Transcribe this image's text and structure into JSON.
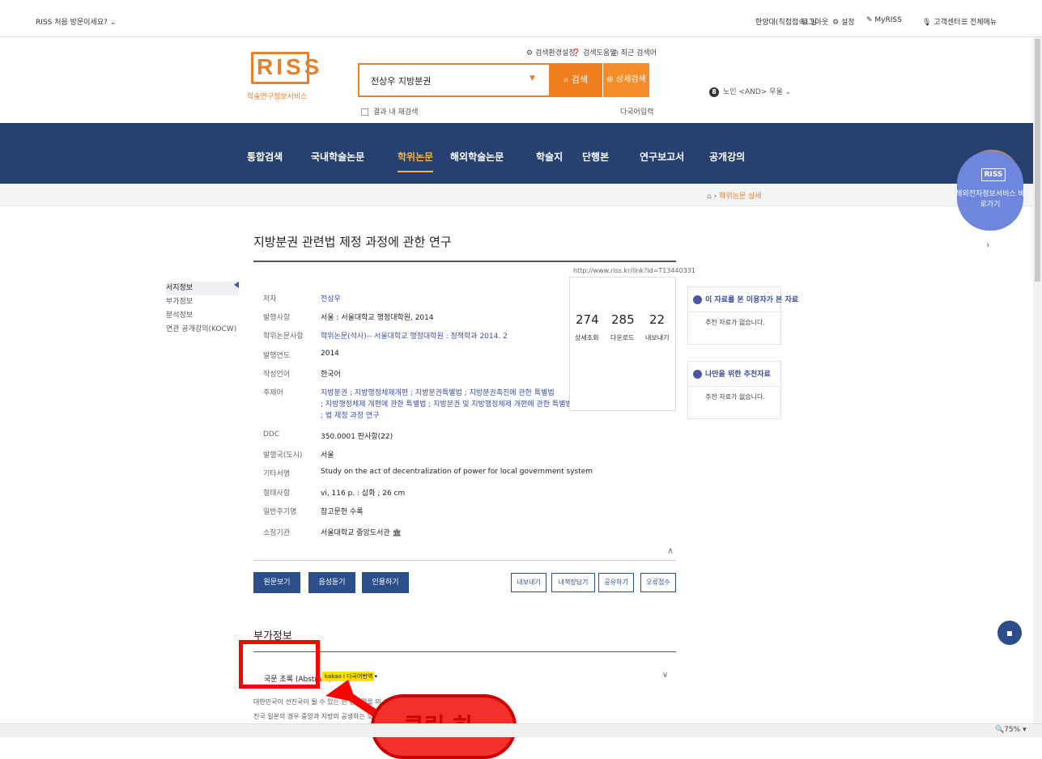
{
  "topbar": {
    "welcome": "RISS 처음 방문이세요? ⌄",
    "user": "한양대(직접접속) 님",
    "logout": "로그아웃",
    "settings": "설정",
    "myriss": "MyRISS",
    "support": "고객센터",
    "menu": "전체메뉴"
  },
  "header": {
    "logo_text": "RISS",
    "logo_sub": "학술연구정보서비스",
    "quick_links": [
      "검색환경설정",
      "검색도움말",
      "최근 검색어"
    ],
    "search_value": "전상우 지방분권",
    "search_button": "검색",
    "advanced_button": "상세검색",
    "within_results": "결과 내 재검색",
    "multilang": "다국어입력",
    "trending_rank": "8",
    "trending_text": "노인 <AND> 우울 ⌄"
  },
  "gnb": {
    "items": [
      "통합검색",
      "국내학술논문",
      "학위논문",
      "해외학술논문",
      "학술지",
      "단행본",
      "연구보고서",
      "공개강의"
    ],
    "active_index": 2
  },
  "breadcrumb": {
    "home": "⌂",
    "current": "학위논문 상세"
  },
  "float_banner": {
    "logo": "RISS",
    "text": "해외전자정보서비스 바로가기",
    "next": "›"
  },
  "article": {
    "title": "지방분권 관련법 제정 과정에 관한 연구",
    "url": "http://www.riss.kr/link?id=T13440331",
    "left_nav": [
      "서지정보",
      "부가정보",
      "분석정보",
      "연관 공개강의(KOCW)"
    ],
    "fields": [
      {
        "label": "저자",
        "value": "전상우",
        "link": true
      },
      {
        "label": "발행사항",
        "value": "서울 : 서울대학교 행정대학원, 2014",
        "link": false
      },
      {
        "label": "학위논문사항",
        "value": "학위논문(석사)-- 서울대학교 행정대학원 : 정책학과 2014. 2",
        "link": true
      },
      {
        "label": "발행연도",
        "value": "2014",
        "link": false
      },
      {
        "label": "작성언어",
        "value": "한국어",
        "link": false
      },
      {
        "label": "주제어",
        "value": "지방분권 ; 지방행정체제개편 ; 지방분권특별법 ; 지방분권촉진에 관한 특별법",
        "value2": "; 지방행정체제 개편에 관한 특별법 ; 지방분권 및 지방행정체제 개편에 관한 특별법",
        "value3": "; 법 제정 과정 연구",
        "link": true
      },
      {
        "label": "DDC",
        "value": "350.0001 판사항(22)",
        "link": false
      },
      {
        "label": "발행국(도시)",
        "value": "서울",
        "link": false
      },
      {
        "label": "기타서명",
        "value": "Study on the act of decentralization of power for local government system",
        "link": false
      },
      {
        "label": "형태사항",
        "value": "vi, 116 p. : 삽화 ; 26 cm",
        "link": false
      },
      {
        "label": "일반주기명",
        "value": "참고문헌 수록",
        "link": false
      },
      {
        "label": "소장기관",
        "value": "서울대학교 중앙도서관 🏛",
        "link": false
      }
    ],
    "stats": [
      {
        "num": "274",
        "label": "상세조회"
      },
      {
        "num": "285",
        "label": "다운로드"
      },
      {
        "num": "22",
        "label": "내보내기"
      }
    ],
    "rec_cards": [
      {
        "title": "이 자료를 본 이용자가 본 자료",
        "body": "추천 자료가 없습니다."
      },
      {
        "title": "나만을 위한 추천자료",
        "body": "추천 자료가 없습니다."
      }
    ],
    "primary_buttons": [
      "원문보기",
      "음성듣기",
      "인용하기"
    ],
    "secondary_buttons": [
      "내보내기",
      "내책장담기",
      "공유하기",
      "오류접수"
    ],
    "section_title": "부가정보",
    "abstract_title": "국문 초록 (Abstract)",
    "kakao_label": "kakao i 다국어번역 ▾",
    "abstract_line1": "대한민국이 선진국이 될 수 있는                         한 경제력을                                         의 선진국과 아시아의 경제 선",
    "abstract_line2": "진국 일본의 경우 중앙과 지방의 공생하는 모습이 늘..."
  },
  "annotation": {
    "callout_text": "클릭 하"
  },
  "status": {
    "zoom": "🔍75%  ▾"
  },
  "colors": {
    "brand_orange": "#f07f1f",
    "nav_blue": "#26406f",
    "active_gold": "#f6b13f",
    "link_blue": "#3b4fa1",
    "annotation_red": "#ff0000"
  }
}
